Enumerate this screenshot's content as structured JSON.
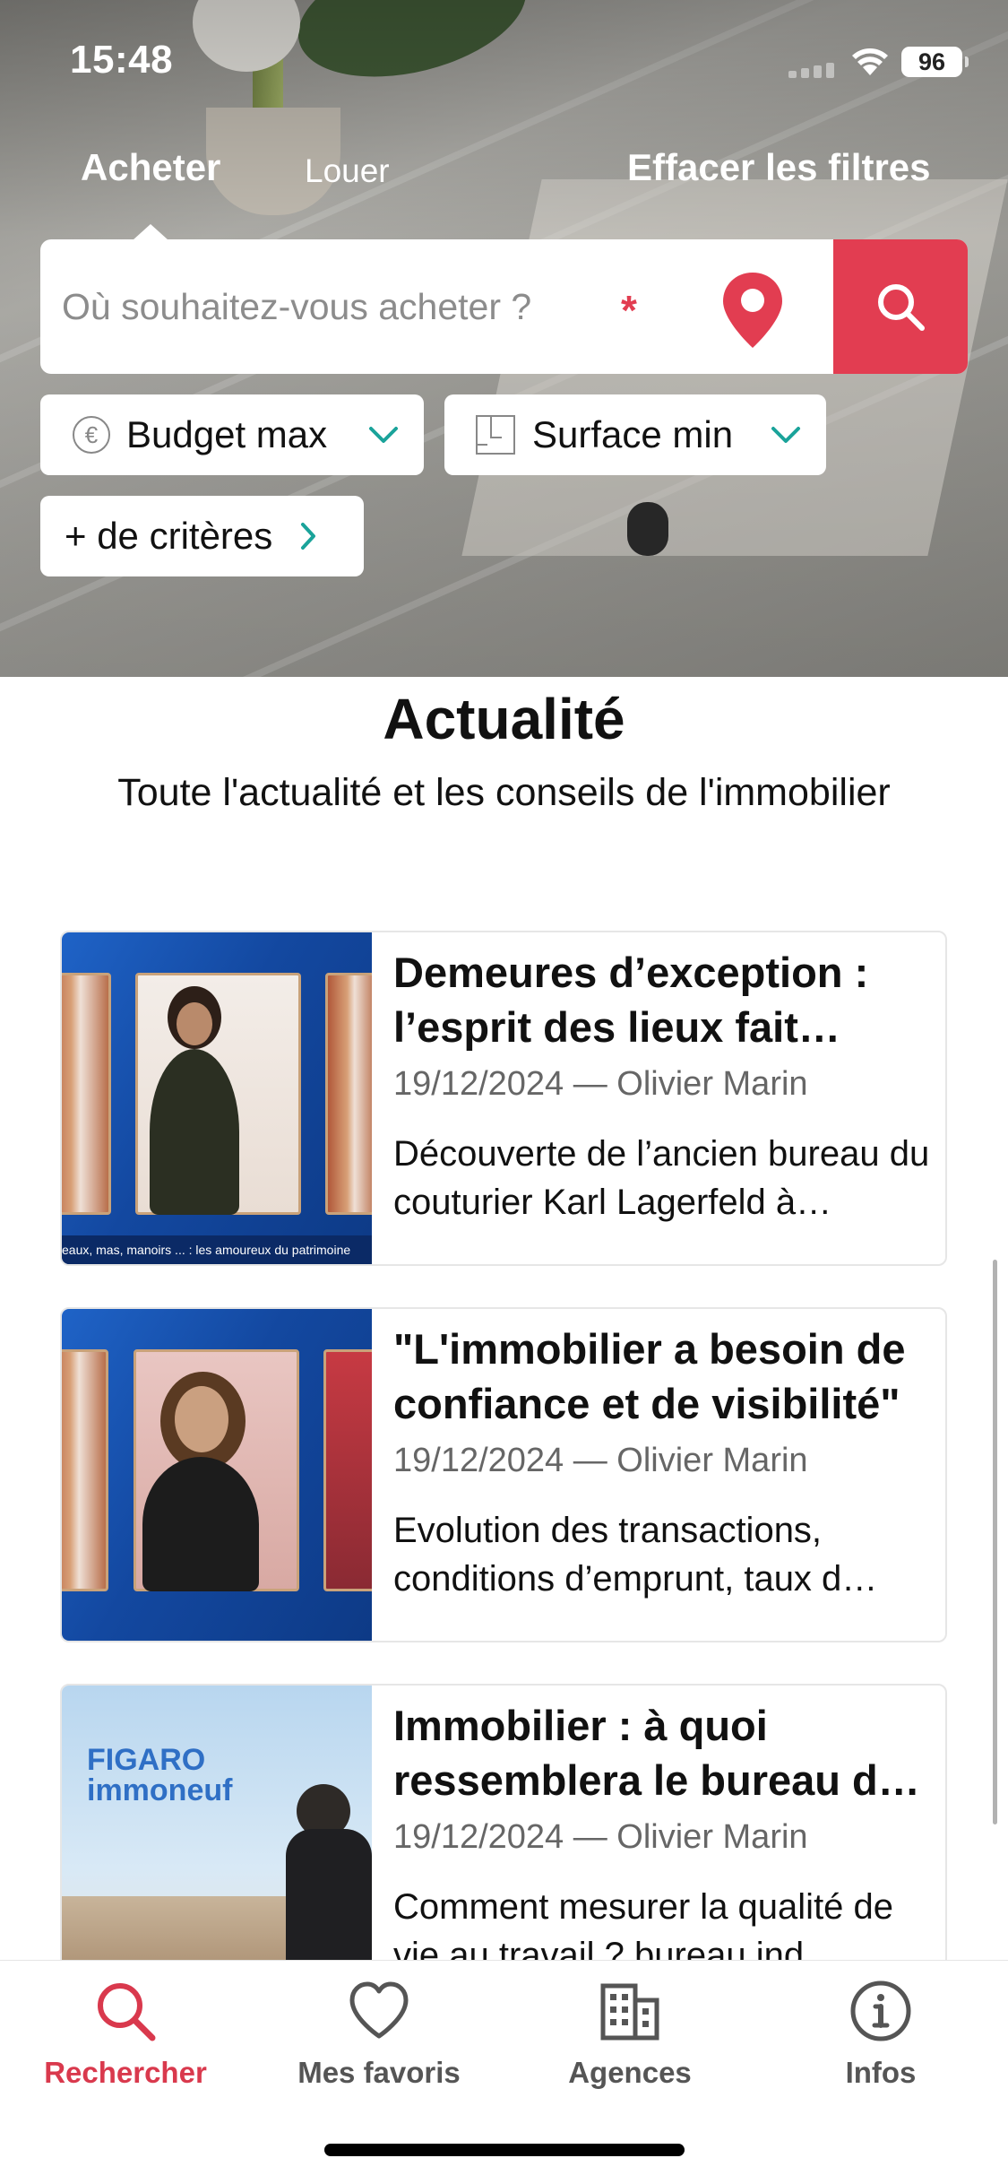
{
  "status_bar": {
    "time": "15:48",
    "battery": "96"
  },
  "header": {
    "tabs": [
      {
        "label": "Acheter",
        "active": true
      },
      {
        "label": "Louer",
        "active": false
      }
    ],
    "clear_filters_label": "Effacer les filtres"
  },
  "search": {
    "placeholder": "Où souhaitez-vous acheter ?",
    "required_marker": "*",
    "location_icon": "map-pin-icon",
    "search_icon": "magnifier-icon"
  },
  "filters": {
    "budget": {
      "label": "Budget max",
      "icon": "euro-icon"
    },
    "surface": {
      "label": "Surface min",
      "icon": "floor-plan-icon"
    },
    "more": {
      "label": "+ de critères",
      "icon": "chevron-right-icon"
    }
  },
  "news": {
    "title": "Actualité",
    "subtitle": "Toute l'actualité et les conseils de l'immobilier",
    "articles": [
      {
        "headline": "Demeures d’exception : l’esprit des lieux fait toujours rêver",
        "meta": "19/12/2024 — Olivier Marin",
        "excerpt": "Découverte de l’ancien bureau du couturier Karl Lagerfeld à…",
        "thumb_caption": "eaux, mas, manoirs ... : les amoureux du patrimoine"
      },
      {
        "headline": "\"L'immobilier a besoin de confiance et de visibilité\"",
        "meta": "19/12/2024 — Olivier Marin",
        "excerpt": "Evolution des transactions, conditions d’emprunt, taux d…"
      },
      {
        "headline": "Immobilier : à quoi ressemblera le bureau de demain ?",
        "meta": "19/12/2024 — Olivier Marin",
        "excerpt": "Comment mesurer la qualité de vie au travail ? bureau ind…",
        "thumb_logo": [
          "FIGARO",
          "immoneuf"
        ]
      }
    ]
  },
  "tabbar": [
    {
      "label": "Rechercher",
      "icon": "search-icon",
      "active": true
    },
    {
      "label": "Mes favoris",
      "icon": "heart-icon",
      "active": false
    },
    {
      "label": "Agences",
      "icon": "building-icon",
      "active": false
    },
    {
      "label": "Infos",
      "icon": "info-icon",
      "active": false
    }
  ],
  "colors": {
    "accent": "#e23d51",
    "teal": "#1aa39a",
    "tab_active": "#d9394d"
  }
}
